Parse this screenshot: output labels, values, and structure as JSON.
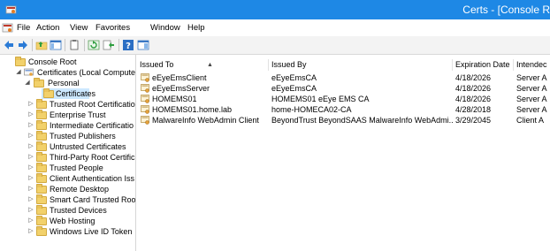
{
  "titlebar": {
    "title": "Certs - [Console R"
  },
  "menu": [
    "File",
    "Action",
    "View",
    "Favorites",
    "Window",
    "Help"
  ],
  "toolbar_icons": [
    "back-arrow-icon",
    "forward-arrow-icon",
    "up-folder-icon",
    "show-hide-tree-icon",
    "copy-icon",
    "refresh-icon",
    "export-list-icon",
    "help-icon",
    "show-hide-action-pane-icon"
  ],
  "tree": {
    "root": "Console Root",
    "certificates": "Certificates (Local Compute",
    "personal": "Personal",
    "personal_certificates": "Certificates",
    "stores": [
      "Trusted Root Certificatio",
      "Enterprise Trust",
      "Intermediate Certificatio",
      "Trusted Publishers",
      "Untrusted Certificates",
      "Third-Party Root Certific",
      "Trusted People",
      "Client Authentication Iss",
      "Remote Desktop",
      "Smart Card Trusted Roo",
      "Trusted Devices",
      "Web Hosting",
      "Windows Live ID Token"
    ]
  },
  "list": {
    "headers": {
      "issued_to": "Issued To",
      "issued_by": "Issued By",
      "expiration": "Expiration Date",
      "intended": "Intendec"
    },
    "rows": [
      {
        "issued_to": "eEyeEmsClient",
        "issued_by": "eEyeEmsCA",
        "expiration": "4/18/2026",
        "intended": "Server A"
      },
      {
        "issued_to": "eEyeEmsServer",
        "issued_by": "eEyeEmsCA",
        "expiration": "4/18/2026",
        "intended": "Server A"
      },
      {
        "issued_to": "HOMEMS01",
        "issued_by": "HOMEMS01 eEye EMS CA",
        "expiration": "4/18/2026",
        "intended": "Server A"
      },
      {
        "issued_to": "HOMEMS01.home.lab",
        "issued_by": "home-HOMECA02-CA",
        "expiration": "4/28/2018",
        "intended": "Server A"
      },
      {
        "issued_to": "MalwareInfo WebAdmin Client",
        "issued_by": "BeyondTrust BeyondSAAS MalwareInfo WebAdmi...",
        "expiration": "3/29/2045",
        "intended": "Client A"
      }
    ]
  }
}
